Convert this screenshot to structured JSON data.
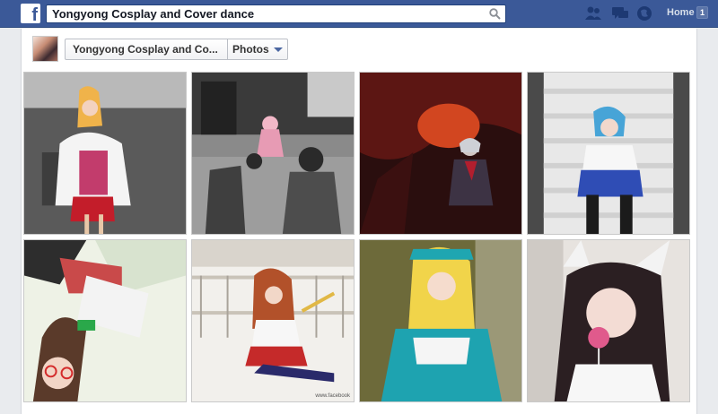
{
  "header": {
    "logo": "f",
    "search_value": "Yongyong Cosplay and Cover dance",
    "home_label": "Home",
    "home_badge": "1"
  },
  "breadcrumb": {
    "page_label": "Yongyong Cosplay and Co...",
    "section_label": "Photos"
  },
  "photos": [
    {
      "stamp": ""
    },
    {
      "stamp": ""
    },
    {
      "stamp": ""
    },
    {
      "stamp": ""
    },
    {
      "stamp": ""
    },
    {
      "stamp": "www.facebook"
    },
    {
      "stamp": ""
    },
    {
      "stamp": ""
    }
  ],
  "colors": {
    "brand": "#3b5998",
    "page_bg": "#e9ebee"
  }
}
